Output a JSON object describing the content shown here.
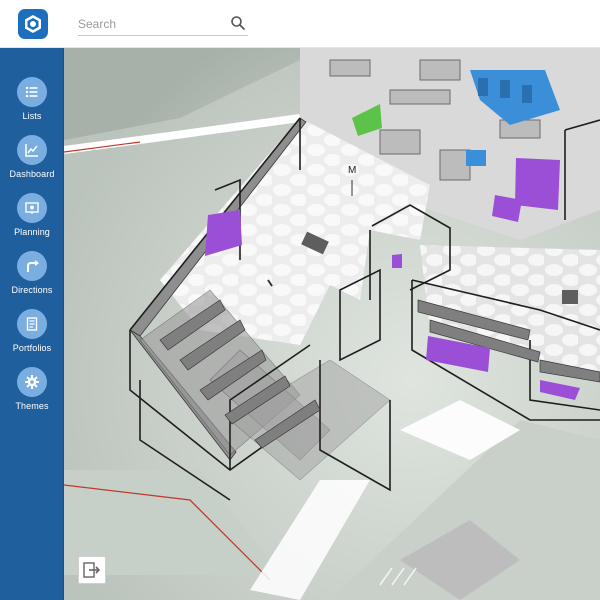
{
  "header": {
    "search": {
      "placeholder": "Search",
      "value": ""
    },
    "logo_icon": "hexagon-logo-icon"
  },
  "sidebar": {
    "items": [
      {
        "label": "Lists",
        "icon": "list-icon"
      },
      {
        "label": "Dashboard",
        "icon": "dashboard-icon"
      },
      {
        "label": "Planning",
        "icon": "planning-icon"
      },
      {
        "label": "Directions",
        "icon": "directions-icon"
      },
      {
        "label": "Portfolios",
        "icon": "portfolio-icon"
      },
      {
        "label": "Themes",
        "icon": "gear-icon"
      }
    ]
  },
  "map": {
    "label": "M",
    "exit_icon": "exit-floor-icon"
  },
  "colors": {
    "brand": "#1f5f9e",
    "nav_circle": "#7aaee0",
    "purple_space": "#9b4fd6",
    "blue_space": "#3b8fd8",
    "green_space": "#5dc24a"
  }
}
